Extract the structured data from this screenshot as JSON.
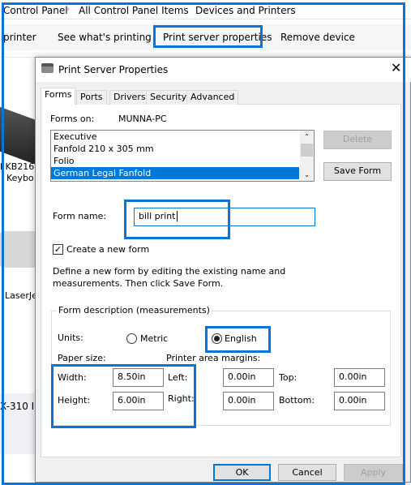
{
  "explorer": {
    "breadcrumb": [
      "Control Panel",
      "All Control Panel Items",
      "Devices and Printers"
    ],
    "toolbar": [
      "printer",
      "See what's printing",
      "Print server properties",
      "Remove device"
    ],
    "devices": [
      "l KB216",
      "Keybo",
      "LaserJe",
      "X-310 I"
    ]
  },
  "dialog": {
    "title": "Print Server Properties",
    "tabs": [
      "Forms",
      "Ports",
      "Drivers",
      "Security",
      "Advanced"
    ],
    "forms_on_label": "Forms on:",
    "forms_on_value": "MUNNA-PC",
    "forms_list": [
      "Executive",
      "Fanfold 210 x 305 mm",
      "Folio",
      "German Legal Fanfold"
    ],
    "selected_form": "German Legal Fanfold",
    "delete_label": "Delete",
    "save_form_label": "Save Form",
    "form_name_label": "Form name:",
    "form_name_value": "bill print",
    "create_new_label": "Create a new form",
    "create_new_checked": true,
    "help_line1": "Define a new form by editing the existing name and",
    "help_line2": "measurements. Then click Save Form.",
    "group_label": "Form description (measurements)",
    "units_label": "Units:",
    "metric_label": "Metric",
    "english_label": "English",
    "units_selected": "English",
    "paper_size_label": "Paper size:",
    "margins_label": "Printer area margins:",
    "width_label": "Width:",
    "width_value": "8.50in",
    "height_label": "Height:",
    "height_value": "6.00in",
    "left_label": "Left:",
    "left_value": "0.00in",
    "right_label": "Right:",
    "right_value": "0.00in",
    "top_label": "Top:",
    "top_value": "0.00in",
    "bottom_label": "Bottom:",
    "bottom_value": "0.00in",
    "ok_label": "OK",
    "cancel_label": "Cancel",
    "apply_label": "Apply"
  },
  "colors": {
    "accent": "#0a74d8",
    "selection": "#0078d7"
  }
}
